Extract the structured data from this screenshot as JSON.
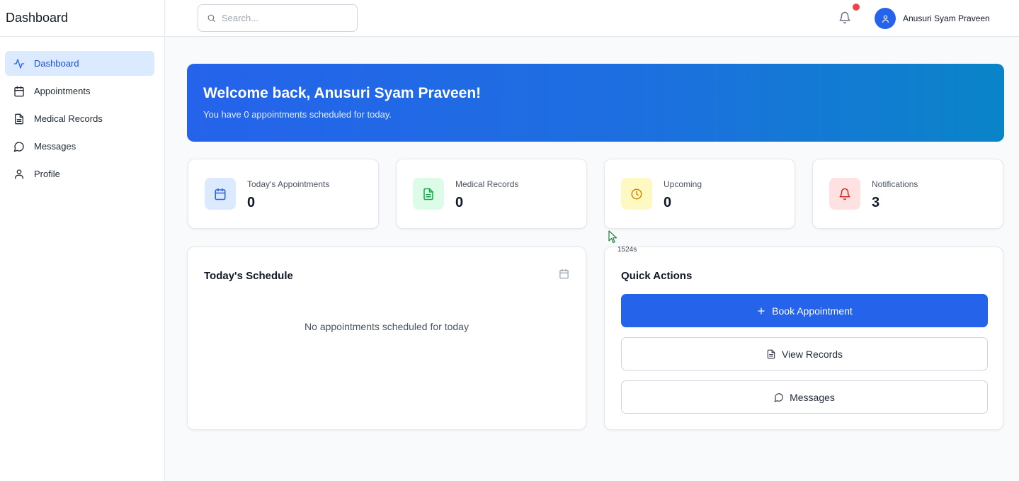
{
  "sidebar": {
    "title": "Dashboard",
    "items": [
      {
        "label": "Dashboard",
        "icon": "activity-icon",
        "active": true
      },
      {
        "label": "Appointments",
        "icon": "calendar-icon",
        "active": false
      },
      {
        "label": "Medical Records",
        "icon": "file-icon",
        "active": false
      },
      {
        "label": "Messages",
        "icon": "message-icon",
        "active": false
      },
      {
        "label": "Profile",
        "icon": "user-icon",
        "active": false
      }
    ]
  },
  "topbar": {
    "search_placeholder": "Search...",
    "user_name": "Anusuri Syam Praveen",
    "notification_dot_color": "#ef4444"
  },
  "banner": {
    "title": "Welcome back, Anusuri Syam Praveen!",
    "subtitle": "You have 0 appointments scheduled for today."
  },
  "stats": [
    {
      "label": "Today's Appointments",
      "value": "0",
      "icon": "calendar-icon",
      "bg": "#dbeafe",
      "color": "#2563eb"
    },
    {
      "label": "Medical Records",
      "value": "0",
      "icon": "file-text-icon",
      "bg": "#dcfce7",
      "color": "#16a34a"
    },
    {
      "label": "Upcoming",
      "value": "0",
      "icon": "clock-icon",
      "bg": "#fef9c3",
      "color": "#ca8a04"
    },
    {
      "label": "Notifications",
      "value": "3",
      "icon": "bell-icon",
      "bg": "#fee2e2",
      "color": "#dc2626"
    }
  ],
  "schedule": {
    "title": "Today's Schedule",
    "empty_message": "No appointments scheduled for today"
  },
  "overlay": {
    "timer_text": "1524s"
  },
  "quick_actions": {
    "title": "Quick Actions",
    "book_label": "Book Appointment",
    "records_label": "View Records",
    "messages_label": "Messages"
  },
  "colors": {
    "accent": "#2563eb",
    "active_nav_bg": "#dbeafe"
  }
}
